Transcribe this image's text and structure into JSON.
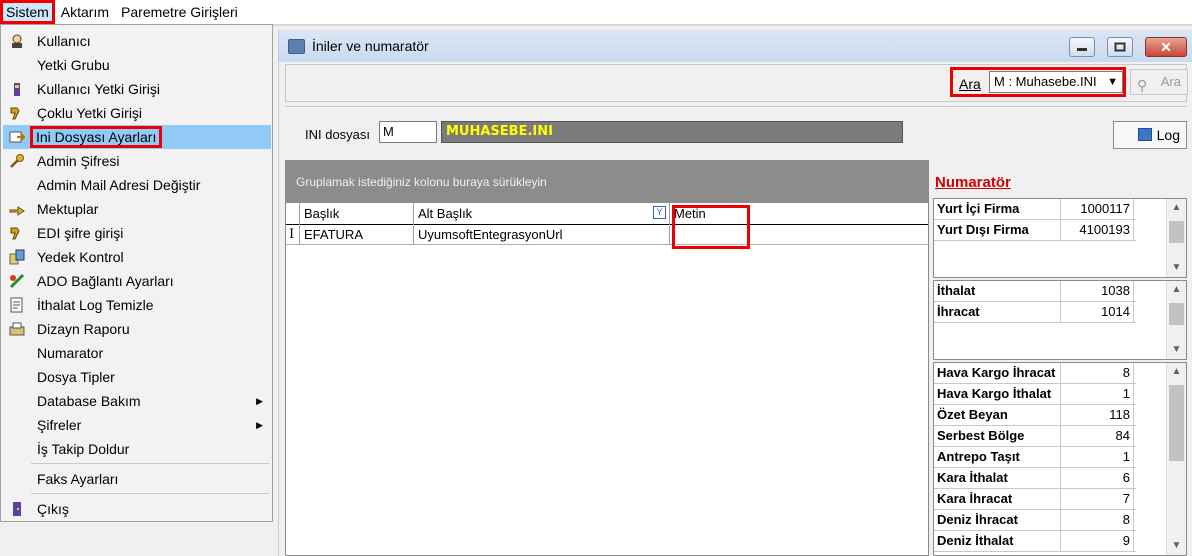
{
  "menubar": {
    "items": [
      "Sistem",
      "Aktarım",
      "Paremetre Girişleri"
    ]
  },
  "dropdown": {
    "items": [
      {
        "label": "Kullanıcı",
        "icon": "user-icon"
      },
      {
        "label": "Yetki Grubu",
        "icon": ""
      },
      {
        "label": "Kullanıcı Yetki Girişi",
        "icon": "key-user-icon"
      },
      {
        "label": "Çoklu Yetki Girişi",
        "icon": "multi-key-icon"
      },
      {
        "label": "Ini Dosyası  Ayarları",
        "icon": "ini-file-icon"
      },
      {
        "label": "Admin Şifresi",
        "icon": "key-icon"
      },
      {
        "label": "Admin Mail Adresi Değiştir",
        "icon": ""
      },
      {
        "label": "Mektuplar",
        "icon": "letter-icon"
      },
      {
        "label": "EDI şifre girişi",
        "icon": "edi-key-icon"
      },
      {
        "label": "Yedek Kontrol",
        "icon": "backup-icon"
      },
      {
        "label": "ADO Bağlantı Ayarları",
        "icon": "connection-icon"
      },
      {
        "label": "İthalat Log Temizle",
        "icon": "log-clean-icon"
      },
      {
        "label": "Dizayn Raporu",
        "icon": "report-icon"
      },
      {
        "label": "Numarator",
        "icon": ""
      },
      {
        "label": "Dosya Tipler",
        "icon": ""
      },
      {
        "label": "Database Bakım",
        "icon": "",
        "submenu": true
      },
      {
        "label": "Şifreler",
        "icon": "",
        "submenu": true
      },
      {
        "label": "İş Takip Doldur",
        "icon": ""
      },
      {
        "label": "Faks Ayarları",
        "icon": ""
      },
      {
        "label": "Çıkış",
        "icon": "exit-icon"
      }
    ]
  },
  "window": {
    "title": "İniler ve numaratör",
    "search_label": "Ara",
    "search_value": "M : Muhasebe.INI",
    "search_button": "Ara",
    "ini_label": "INI dosyası",
    "ini_value": "M",
    "ini_name": "MUHASEBE.INI",
    "log_button": "Log"
  },
  "grid": {
    "group_hint": "Gruplamak istediğiniz kolonu buraya sürükleyin",
    "columns": [
      "Başlık",
      "Alt Başlık",
      "Metin"
    ],
    "rows": [
      {
        "baslik": "EFATURA",
        "alt": "UyumsoftEntegrasyonUrl",
        "metin": ""
      }
    ]
  },
  "numarator": {
    "title": "Numaratör",
    "group1": [
      {
        "k": "Yurt İçi Firma",
        "v": "1000117"
      },
      {
        "k": "Yurt Dışı Firma",
        "v": "4100193"
      }
    ],
    "group2": [
      {
        "k": "İthalat",
        "v": "1038"
      },
      {
        "k": "İhracat",
        "v": "1014"
      }
    ],
    "group3": [
      {
        "k": "Hava Kargo İhracat",
        "v": "8"
      },
      {
        "k": "Hava Kargo İthalat",
        "v": "1"
      },
      {
        "k": "Özet Beyan",
        "v": "118"
      },
      {
        "k": "Serbest Bölge",
        "v": "84"
      },
      {
        "k": "Antrepo Taşıt",
        "v": "1"
      },
      {
        "k": "Kara İthalat",
        "v": "6"
      },
      {
        "k": "Kara İhracat",
        "v": "7"
      },
      {
        "k": "Deniz İhracat",
        "v": "8"
      },
      {
        "k": "Deniz İthalat",
        "v": "9"
      }
    ]
  },
  "colors": {
    "highlight_red": "#e00000",
    "menu_selected": "#91c9f7",
    "ini_name_text": "#ffff00",
    "numarator_title": "#d20000"
  }
}
